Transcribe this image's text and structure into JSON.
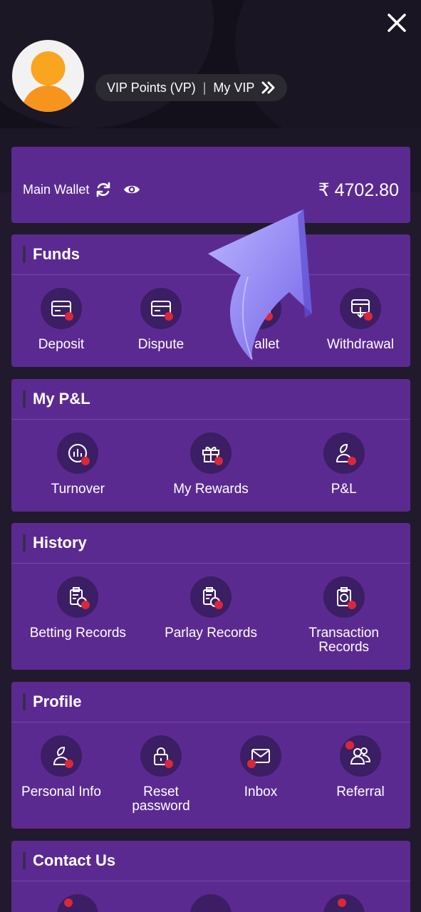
{
  "header": {
    "vip_points_label": "VIP Points (VP)",
    "separator": "|",
    "my_vip_label": "My VIP"
  },
  "wallet": {
    "label": "Main Wallet",
    "amount": "₹ 4702.80"
  },
  "funds": {
    "title": "Funds",
    "items": [
      {
        "label": "Deposit"
      },
      {
        "label": "Dispute"
      },
      {
        "label": "Wallet",
        "partial_visible": "M  Wallet"
      },
      {
        "label": "Withdrawal"
      }
    ]
  },
  "pl": {
    "title": "My P&L",
    "items": [
      {
        "label": "Turnover"
      },
      {
        "label": "My Rewards"
      },
      {
        "label": "P&L"
      }
    ]
  },
  "history": {
    "title": "History",
    "items": [
      {
        "label": "Betting Records"
      },
      {
        "label": "Parlay Records"
      },
      {
        "label": "Transaction Records"
      }
    ]
  },
  "profile": {
    "title": "Profile",
    "items": [
      {
        "label": "Personal Info"
      },
      {
        "label": "Reset password"
      },
      {
        "label": "Inbox"
      },
      {
        "label": "Referral"
      }
    ]
  },
  "contact": {
    "title": "Contact Us"
  },
  "colors": {
    "card": "#5b2a91",
    "icon_circle": "#3b1e63",
    "accent_dot": "#d8283b",
    "avatar_orange": "#f7941d"
  }
}
